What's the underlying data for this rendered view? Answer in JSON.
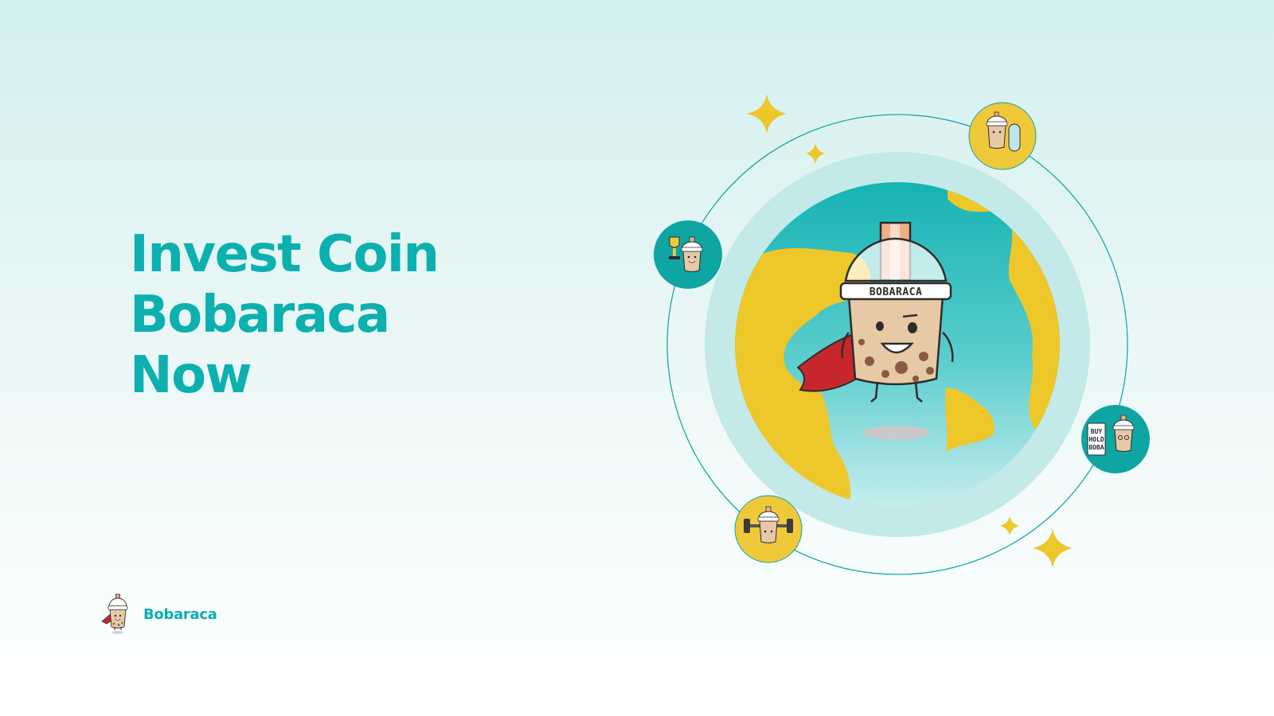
{
  "headline": {
    "line1": "Invest Coin",
    "line2": "Bobaraca",
    "line3": "Now"
  },
  "brand": {
    "name": "Bobaraca",
    "logo_icon": "superhero-boba-mascot-icon"
  },
  "hero": {
    "cup_label": "BOBARACA",
    "badges": [
      {
        "icon": "trophy-boba-mascot-icon",
        "color": "#0ea5a3"
      },
      {
        "icon": "snowboard-boba-mascot-icon",
        "color": "#f0c93a"
      },
      {
        "icon": "buy-hold-boba-mascot-icon",
        "color": "#0ea5a3"
      },
      {
        "icon": "dumbbell-boba-mascot-icon",
        "color": "#f0c93a"
      }
    ],
    "sign_lines": [
      "BUY",
      "HOLD",
      "BOBA"
    ]
  },
  "colors": {
    "accent": "#0cb0ae",
    "gold": "#f0c93a",
    "globe_water": "#3fc3c3",
    "cape": "#c8262d"
  }
}
